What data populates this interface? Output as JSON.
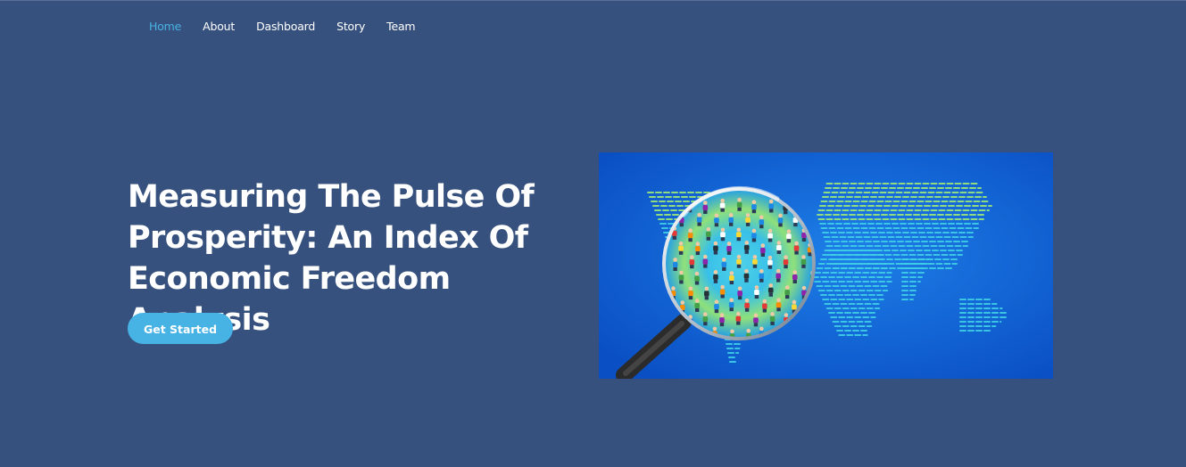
{
  "nav": {
    "items": [
      {
        "label": "Home",
        "active": true
      },
      {
        "label": "About",
        "active": false
      },
      {
        "label": "Dashboard",
        "active": false
      },
      {
        "label": "Story",
        "active": false
      },
      {
        "label": "Team",
        "active": false
      }
    ]
  },
  "hero": {
    "title": "Measuring The Pulse Of Prosperity: An Index Of Economic Freedom Analysis",
    "cta_label": "Get Started",
    "image": "magnifying-glass-over-world-map-people"
  },
  "colors": {
    "background": "#37517e",
    "accent": "#47b2e4",
    "text": "#ffffff"
  }
}
